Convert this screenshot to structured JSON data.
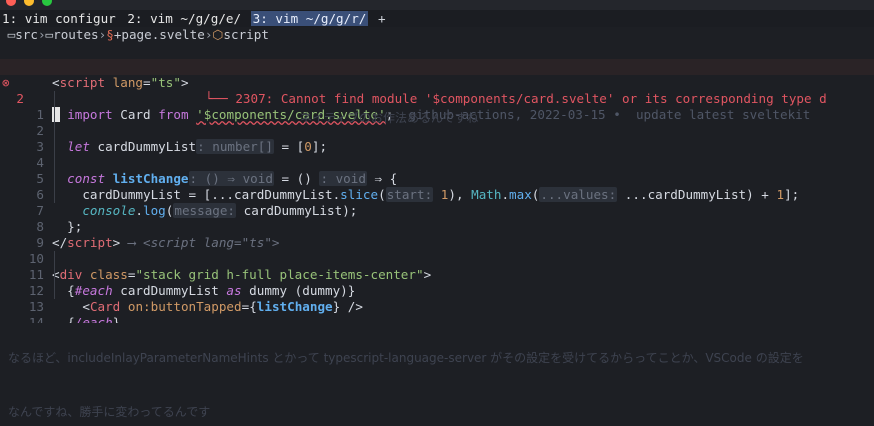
{
  "tabline": {
    "tabs": [
      {
        "label": "1: vim configur",
        "active": false
      },
      {
        "label": "2: vim ~/g/g/e/",
        "active": false
      },
      {
        "label": "3: vim ~/g/g/r/",
        "active": true
      }
    ],
    "add_label": "+"
  },
  "breadcrumb": {
    "items": [
      {
        "label": "src",
        "icon": "folder-icon"
      },
      {
        "label": "routes",
        "icon": "folder-icon"
      },
      {
        "label": "+page.svelte",
        "icon": "svelte-file-icon"
      },
      {
        "label": "script",
        "icon": "cube-icon"
      }
    ],
    "separator": "›"
  },
  "editor": {
    "line1": {
      "num": "1",
      "open": "<",
      "tag": "script",
      "attr": " lang",
      "eq": "=",
      "val": "\"ts\"",
      "close": ">"
    },
    "line2": {
      "num": "2",
      "error_icon": "⊗",
      "import_kw": "import",
      "ident": "Card",
      "from_kw": "from",
      "path": "'$components/card.svelte'",
      "semi": ";",
      "blame": "github-actions, 2022-03-15 •  update latest sveltekit"
    },
    "diagnostic": {
      "connector": "└──",
      "message": "2307: Cannot find module '$components/card.svelte' or its corresponding type d"
    },
    "line3": {
      "num": "1"
    },
    "line4": {
      "num": "2",
      "let_kw": "let",
      "name": "cardDummyList",
      "inlay": ": number[]",
      "rest1": " = [",
      "zero": "0",
      "rest2": "];"
    },
    "line5": {
      "num": "3"
    },
    "line6": {
      "num": "4",
      "const_kw": "const",
      "name": "listChange",
      "inlay": ": () ⇒ void",
      "eq": " = ",
      "paren": "()",
      "inlay2": ": void",
      "arrow": " ⇒ {"
    },
    "line7": {
      "num": "5",
      "name": "cardDummyList",
      "p1": " = [...",
      "name2": "cardDummyList",
      "p2": ".",
      "slice": "slice",
      "p3": "(",
      "hint_start": "start:",
      "one": " 1",
      "p4": "), ",
      "math": "Math",
      "p5": ".",
      "max": "max",
      "p6": "(",
      "hint_values": "...values:",
      "p7": " ...",
      "name3": "cardDummyList",
      "p8": ") + ",
      "one2": "1",
      "p9": "];"
    },
    "line8": {
      "num": "6",
      "console": "console",
      "dot": ".",
      "log": "log",
      "p1": "(",
      "hint": "message:",
      "arg": " cardDummyList",
      "p2": ");"
    },
    "line9": {
      "num": "7",
      "text": "};"
    },
    "line10": {
      "num": "8",
      "open": "</",
      "tag": "script",
      "close": ">",
      "virtual": " ⟶ <script lang=\"ts\">"
    },
    "line11": {
      "num": "9"
    },
    "line12": {
      "num": "10",
      "open": "<",
      "tag": "div",
      "attr": " class",
      "eq": "=",
      "val": "\"stack grid h-full place-items-center\"",
      "close": ">"
    },
    "line13": {
      "num": "11",
      "brace_open": "{",
      "each": "#each",
      "name": " cardDummyList ",
      "as": "as",
      "alias": " dummy ",
      "paren": "(dummy)",
      "brace_close": "}"
    },
    "line14": {
      "num": "12",
      "open": "<",
      "tag": "Card",
      "attr": " on:buttonTapped",
      "eq": "=",
      "b1": "{",
      "handler": "listChange",
      "b2": "}",
      "close": " />"
    },
    "line15": {
      "num": "13",
      "brace_open": "{",
      "each": "/each",
      "brace_close": "}"
    },
    "line16": {
      "num": "14",
      "open": "</",
      "tag": "div",
      "close": ">"
    }
  },
  "background": {
    "ghost1": "ネイティブのお作法あるんですね",
    "ghost2": "なるほど、includeInlayParameterNameHints とかって typescript-language-server がその設定を受けてるからってことか、VSCode の設定を",
    "ghost3": "なんですね、勝手に変わってるんです"
  },
  "colors": {
    "accent": "#3a4f78",
    "error": "#e05561",
    "keyword": "#c678dd",
    "string": "#98c379"
  }
}
